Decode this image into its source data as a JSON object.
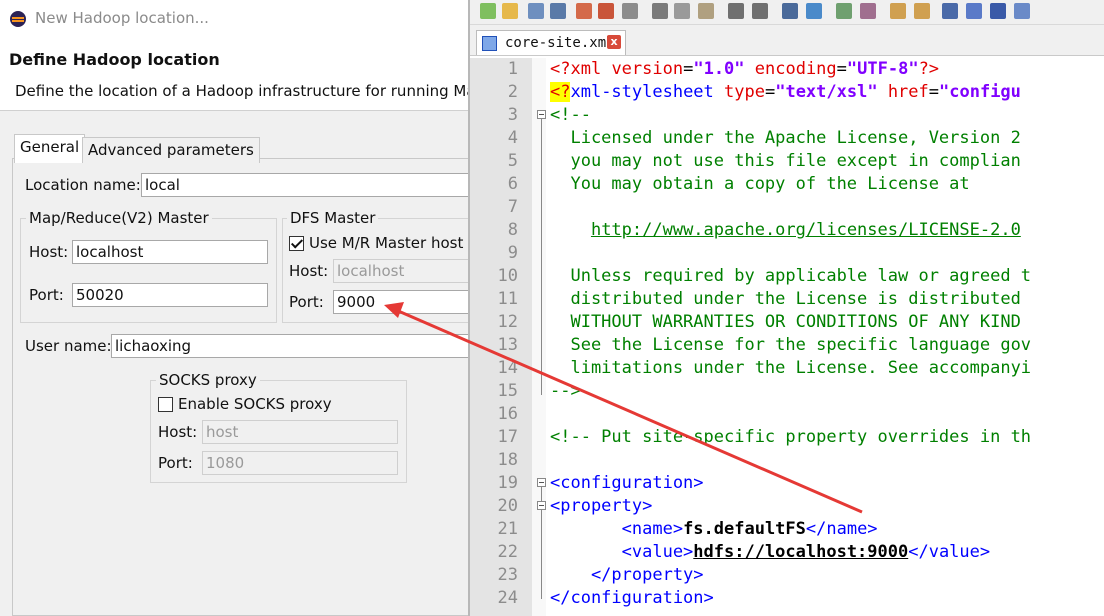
{
  "dialog": {
    "window_title": "New Hadoop location...",
    "header_title": "Define Hadoop location",
    "header_desc": "Define the location of a Hadoop infrastructure for running Map",
    "tabs": [
      "General",
      "Advanced parameters"
    ],
    "location_name_label": "Location name:",
    "location_name_value": "local",
    "mr_master": {
      "title": "Map/Reduce(V2) Master",
      "host_label": "Host:",
      "host_value": "localhost",
      "port_label": "Port:",
      "port_value": "50020"
    },
    "dfs_master": {
      "title": "DFS Master",
      "use_mr_host_label": "Use M/R Master host",
      "use_mr_host_checked": true,
      "host_label": "Host:",
      "host_value": "localhost",
      "port_label": "Port:",
      "port_value": "9000"
    },
    "user_name_label": "User name:",
    "user_name_value": "lichaoxing",
    "socks": {
      "title": "SOCKS proxy",
      "enable_label": "Enable SOCKS proxy",
      "enabled": false,
      "host_label": "Host:",
      "host_value": "host",
      "port_label": "Port:",
      "port_value": "1080"
    }
  },
  "editor": {
    "file_tab": "core-site.xml",
    "close_glyph": "x",
    "toolbar_icons": [
      "new-file-icon",
      "open-file-icon",
      "save-icon",
      "save-all-icon",
      "close-icon",
      "close-all-icon",
      "print-icon",
      "cut-icon",
      "copy-icon",
      "paste-icon",
      "undo-icon",
      "redo-icon",
      "find-icon",
      "replace-icon",
      "zoom-in-icon",
      "zoom-out-icon",
      "sync-v-icon",
      "sync-h-icon",
      "wrap-icon",
      "all-chars-icon",
      "indent-guide-icon",
      "udl-icon"
    ],
    "line_numbers": [
      "1",
      "2",
      "3",
      "4",
      "5",
      "6",
      "7",
      "8",
      "9",
      "10",
      "11",
      "12",
      "13",
      "14",
      "15",
      "16",
      "17",
      "18",
      "19",
      "20",
      "21",
      "22",
      "23",
      "24"
    ],
    "lines": {
      "l1": [
        "<?",
        "xml",
        " version",
        "=",
        "\"1.0\"",
        " encoding",
        "=",
        "\"UTF-8\"",
        "?>"
      ],
      "l2": [
        "<?",
        "xml-stylesheet",
        " type",
        "=",
        "\"text/xsl\"",
        " href",
        "=",
        "\"configu"
      ],
      "l3": "<!--",
      "l4": "  Licensed under the Apache License, Version 2",
      "l5": "  you may not use this file except in complian",
      "l6": "  You may obtain a copy of the License at",
      "l7": "",
      "l8a": "    ",
      "l8b": "http://www.apache.org/licenses/LICENSE-2.0",
      "l9": "",
      "l10": "  Unless required by applicable law or agreed t",
      "l11": "  distributed under the License is distributed",
      "l12": "  WITHOUT WARRANTIES OR CONDITIONS OF ANY KIND",
      "l13": "  See the License for the specific language gov",
      "l14": "  limitations under the License. See accompanyi",
      "l15": "-->",
      "l16": "",
      "l17": "<!-- Put site-specific property overrides in th",
      "l18": "",
      "l19": [
        "<configuration>"
      ],
      "l20": [
        "<property>"
      ],
      "l21": [
        "       <name>",
        "fs.defaultFS",
        "</name>"
      ],
      "l22": [
        "       <value>",
        "hdfs://localhost:9000",
        "</value>"
      ],
      "l23": [
        "    </property>"
      ],
      "l24": [
        "</configuration>"
      ]
    }
  },
  "colors": {
    "arrow": "#e53935",
    "xml_tag": "#0000ff",
    "xml_attr": "#e00000",
    "xml_value": "#8000ff",
    "comment": "#008000"
  }
}
